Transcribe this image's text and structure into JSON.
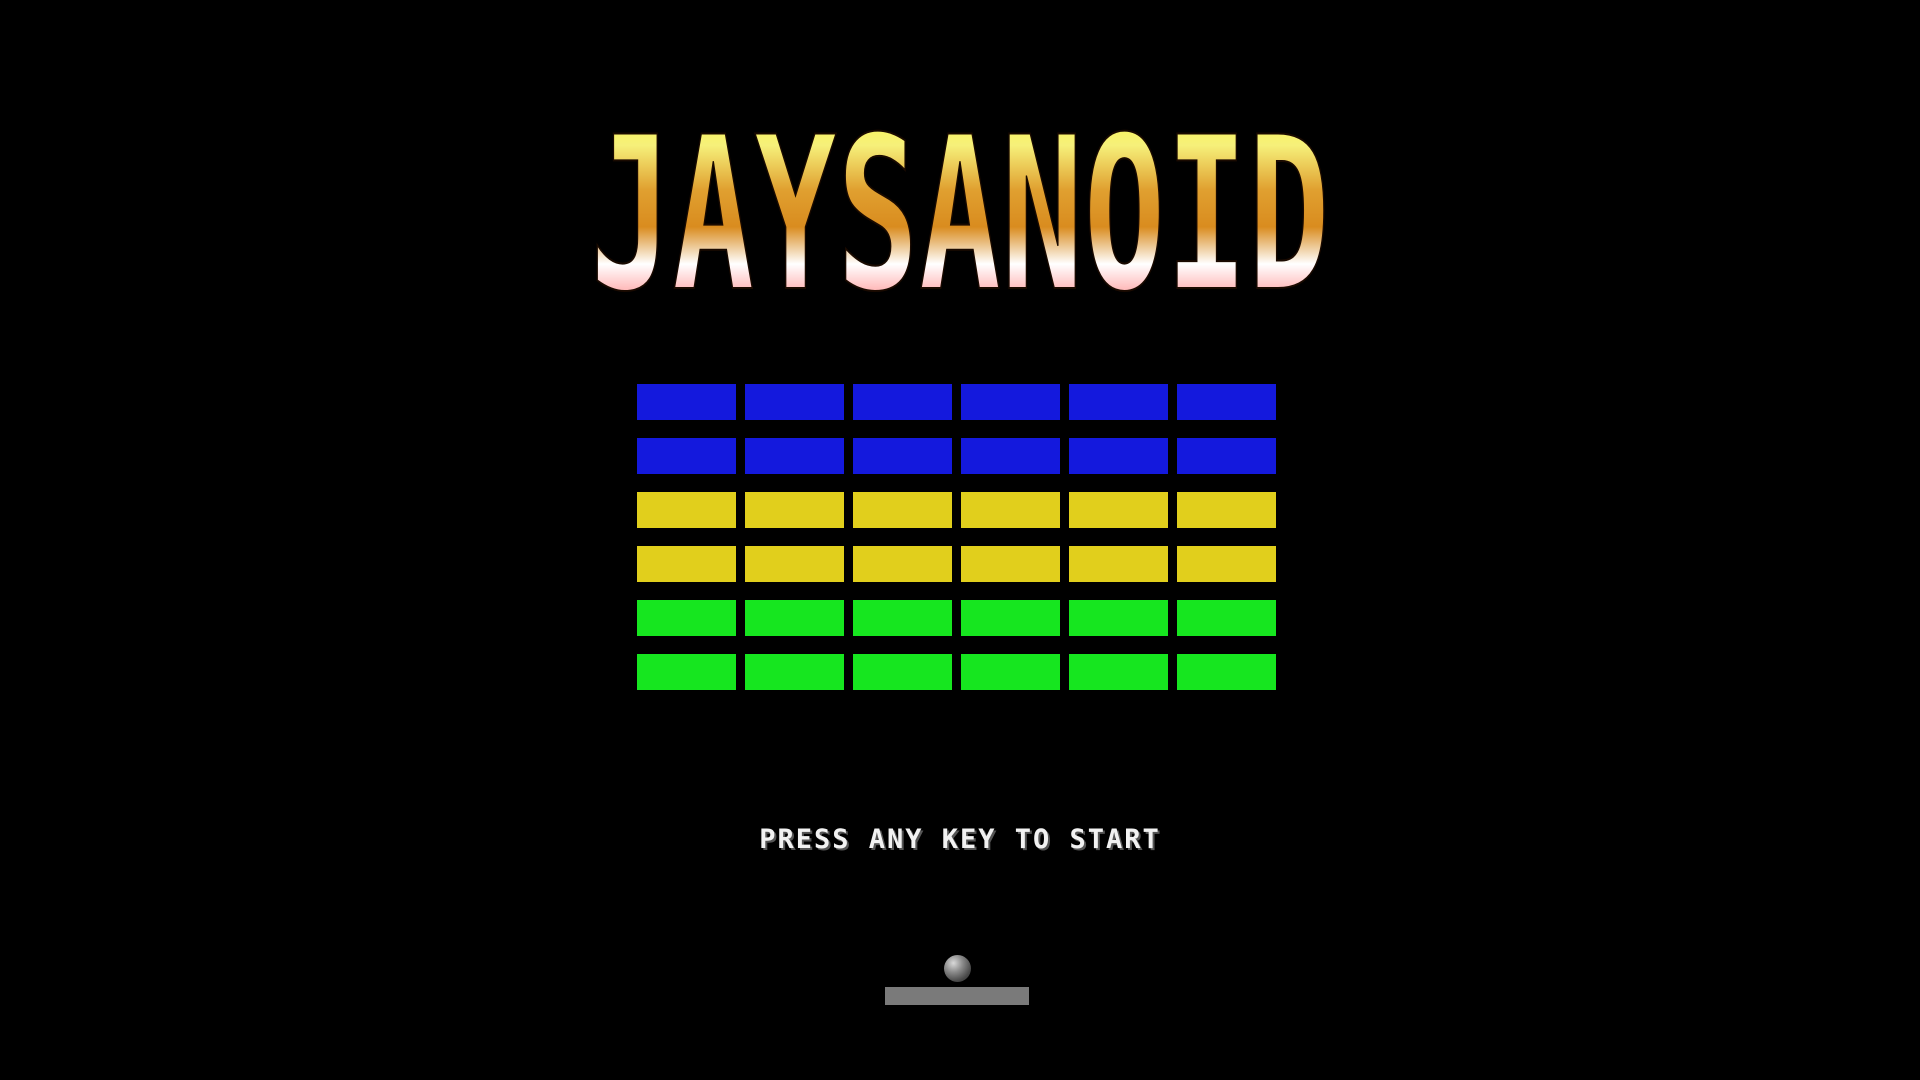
{
  "game": {
    "title": "JAYSANOID",
    "prompt": "PRESS ANY KEY TO START"
  },
  "colors": {
    "background": "#000000",
    "title_gradient": [
      "#ffff33",
      "#f6f07a",
      "#d98c1f",
      "#ffffff",
      "#ff2b2b"
    ],
    "brick_blue": "#1419dd",
    "brick_yellow": "#e1cf1c",
    "brick_green": "#16e61f",
    "paddle": "#7a7a7a",
    "ball": "#6a6a6a"
  },
  "bricks": {
    "rows": [
      {
        "color": "blue",
        "count": 6
      },
      {
        "color": "blue",
        "count": 6
      },
      {
        "color": "yellow",
        "count": 6
      },
      {
        "color": "yellow",
        "count": 6
      },
      {
        "color": "green",
        "count": 6
      },
      {
        "color": "green",
        "count": 6
      }
    ]
  }
}
